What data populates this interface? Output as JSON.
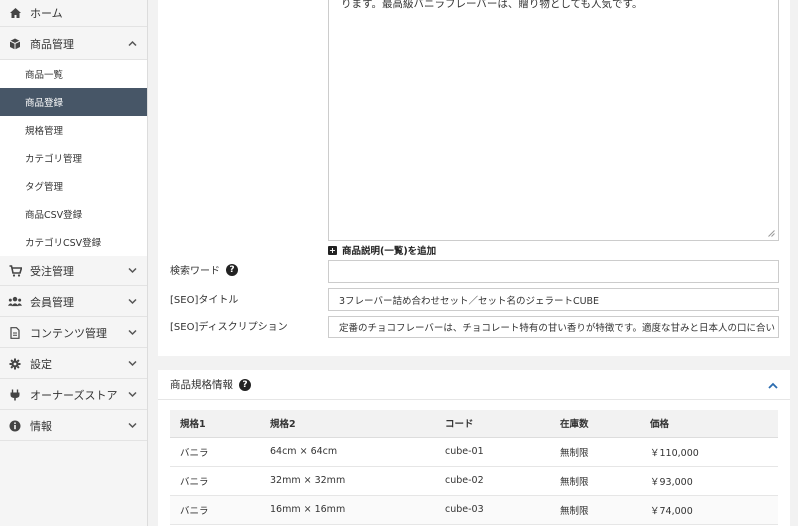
{
  "sidebar": {
    "home": "ホーム",
    "product_mgmt": "商品管理",
    "sub_items": [
      "商品一覧",
      "商品登録",
      "規格管理",
      "カテゴリ管理",
      "タグ管理",
      "商品CSV登録",
      "カテゴリCSV登録"
    ],
    "order_mgmt": "受注管理",
    "member_mgmt": "会員管理",
    "content_mgmt": "コンテンツ管理",
    "settings": "設定",
    "owners_store": "オーナーズストア",
    "info": "情報"
  },
  "form": {
    "description_text": "ります。最高級バニラフレーバーは、贈り物としても人気です。",
    "add_list_description": "商品説明(一覧)を追加",
    "search_word_label": "検索ワード",
    "search_word_value": "",
    "seo_title_label": "[SEO]タイトル",
    "seo_title_value": "3フレーバー詰め合わせセット／セット名のジェラートCUBE",
    "seo_desc_label": "[SEO]ディスクリプション",
    "seo_desc_value": "定番のチョコフレーバーは、チョコレート特有の甘い香りが特徴です。適度な甘みと日本人の口に合い"
  },
  "spec": {
    "title": "商品規格情報",
    "columns": [
      "規格1",
      "規格2",
      "コード",
      "在庫数",
      "価格"
    ],
    "rows": [
      [
        "バニラ",
        "64cm × 64cm",
        "cube-01",
        "無制限",
        "￥110,000"
      ],
      [
        "バニラ",
        "32mm × 32mm",
        "cube-02",
        "無制限",
        "￥93,000"
      ],
      [
        "バニラ",
        "16mm × 16mm",
        "cube-03",
        "無制限",
        "￥74,000"
      ]
    ]
  },
  "colors": {
    "active_bg": "#475667",
    "accent": "#2b6cb0"
  }
}
